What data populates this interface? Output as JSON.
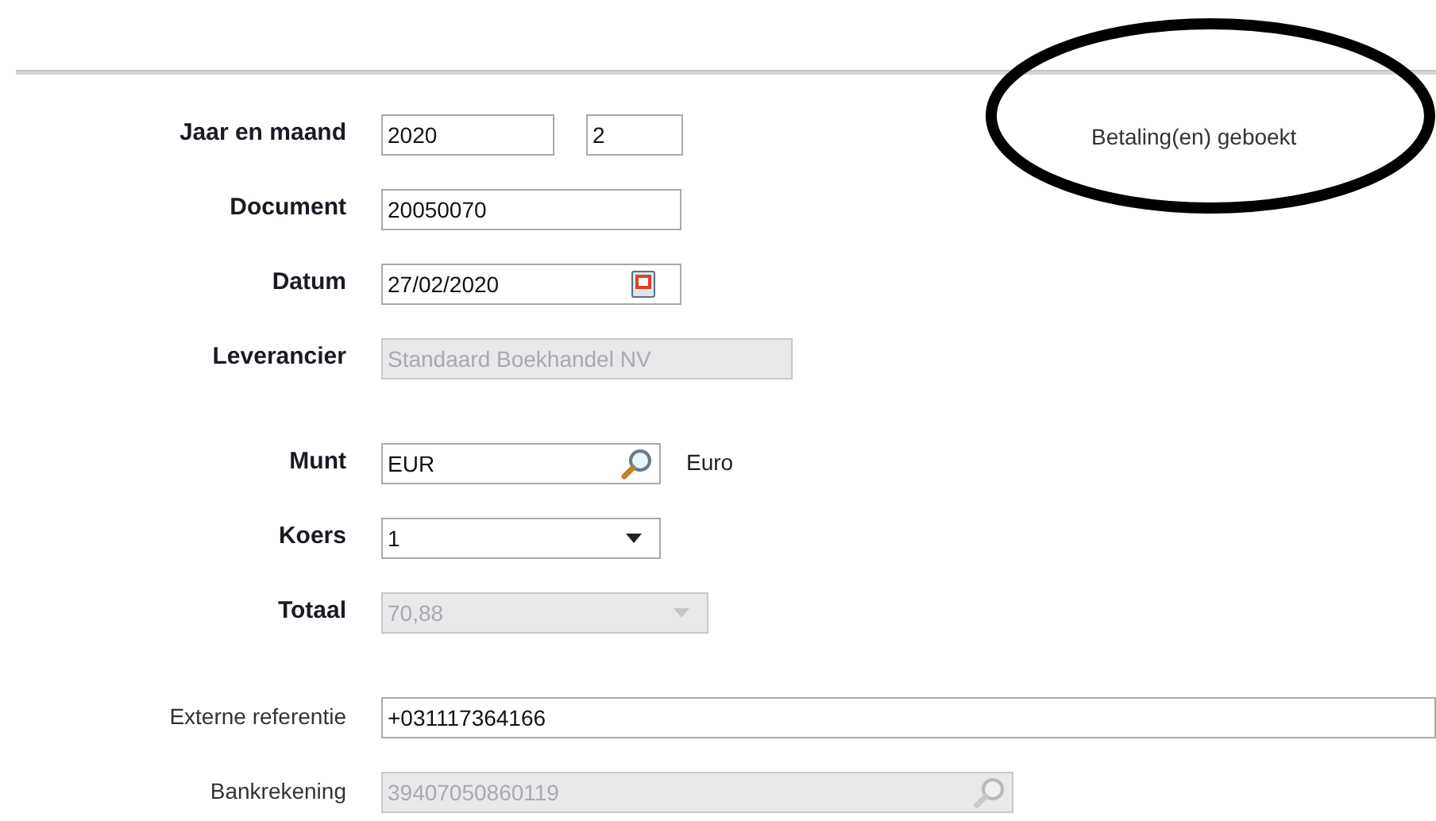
{
  "status_note": {
    "text": "Betaling(en) geboekt",
    "circled": true
  },
  "groups": [
    {
      "rows": [
        {
          "label": "Jaar en maand",
          "bold": true,
          "fields": [
            {
              "kind": "text",
              "value": "2020",
              "disabled": false
            },
            {
              "kind": "text",
              "value": "2",
              "disabled": false
            }
          ]
        },
        {
          "label": "Document",
          "bold": true,
          "fields": [
            {
              "kind": "text",
              "value": "20050070",
              "disabled": false
            }
          ]
        },
        {
          "label": "Datum",
          "bold": true,
          "fields": [
            {
              "kind": "date",
              "value": "27/02/2020",
              "disabled": false
            }
          ]
        },
        {
          "label": "Leverancier",
          "bold": true,
          "fields": [
            {
              "kind": "text",
              "value": "Standaard Boekhandel NV",
              "disabled": true
            }
          ]
        }
      ]
    },
    {
      "rows": [
        {
          "label": "Munt",
          "bold": true,
          "fields": [
            {
              "kind": "lookup",
              "value": "EUR",
              "disabled": false
            }
          ],
          "note": "Euro"
        },
        {
          "label": "Koers",
          "bold": true,
          "fields": [
            {
              "kind": "dropdown",
              "value": "1",
              "disabled": false
            }
          ]
        },
        {
          "label": "Totaal",
          "bold": true,
          "fields": [
            {
              "kind": "dropdown",
              "value": "70,88",
              "disabled": true
            }
          ]
        }
      ]
    },
    {
      "rows": [
        {
          "label": "Externe referentie",
          "bold": false,
          "fields": [
            {
              "kind": "text",
              "value": "+031117364166",
              "disabled": false
            }
          ]
        },
        {
          "label": "Bankrekening",
          "bold": false,
          "fields": [
            {
              "kind": "lookup",
              "value": "39407050860119",
              "disabled": true
            }
          ]
        }
      ]
    }
  ]
}
